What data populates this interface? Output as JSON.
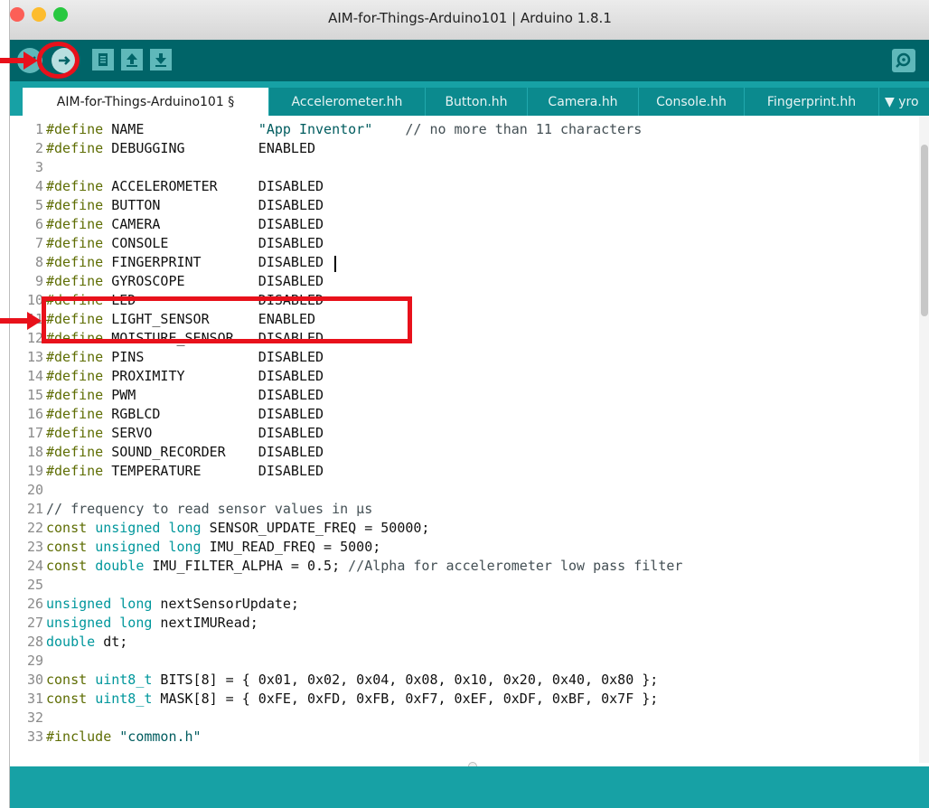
{
  "window": {
    "title": "AIM-for-Things-Arduino101 | Arduino 1.8.1",
    "traffic_colors": [
      "#fc5f57",
      "#fdbc2e",
      "#28c840"
    ]
  },
  "toolbar": {
    "buttons": [
      "verify-icon",
      "upload-icon",
      "new-icon",
      "open-icon",
      "save-icon"
    ],
    "serial_monitor": "magnifier-icon"
  },
  "tabs": [
    {
      "label": "AIM-for-Things-Arduino101 §",
      "active": true
    },
    {
      "label": "Accelerometer.hh"
    },
    {
      "label": "Button.hh"
    },
    {
      "label": "Camera.hh"
    },
    {
      "label": "Console.hh"
    },
    {
      "label": "Fingerprint.hh"
    },
    {
      "label": "▼ yro"
    }
  ],
  "colors": {
    "toolbar_bg": "#006468",
    "tab_bg": "#17a1a5",
    "annotation": "#e8111b",
    "keyword": "#5e6d03",
    "type": "#00979c"
  },
  "code": [
    "#define NAME              \"App Inventor\"    // no more than 11 characters",
    "#define DEBUGGING         ENABLED",
    "",
    "#define ACCELEROMETER     DISABLED",
    "#define BUTTON            DISABLED",
    "#define CAMERA            DISABLED",
    "#define CONSOLE           DISABLED",
    "#define FINGERPRINT       DISABLED",
    "#define GYROSCOPE         DISABLED",
    "#define LED               DISABLED",
    "#define LIGHT_SENSOR      ENABLED",
    "#define MOISTURE_SENSOR   DISABLED",
    "#define PINS              DISABLED",
    "#define PROXIMITY         DISABLED",
    "#define PWM               DISABLED",
    "#define RGBLCD            DISABLED",
    "#define SERVO             DISABLED",
    "#define SOUND_RECORDER    DISABLED",
    "#define TEMPERATURE       DISABLED",
    "",
    "// frequency to read sensor values in µs",
    "const unsigned long SENSOR_UPDATE_FREQ = 50000;",
    "const unsigned long IMU_READ_FREQ = 5000;",
    "const double IMU_FILTER_ALPHA = 0.5; //Alpha for accelerometer low pass filter",
    "",
    "unsigned long nextSensorUpdate;",
    "unsigned long nextIMURead;",
    "double dt;",
    "",
    "const uint8_t BITS[8] = { 0x01, 0x02, 0x04, 0x08, 0x10, 0x20, 0x40, 0x80 };",
    "const uint8_t MASK[8] = { 0xFE, 0xFD, 0xFB, 0xF7, 0xEF, 0xDF, 0xBF, 0x7F };",
    "",
    "#include \"common.h\""
  ]
}
